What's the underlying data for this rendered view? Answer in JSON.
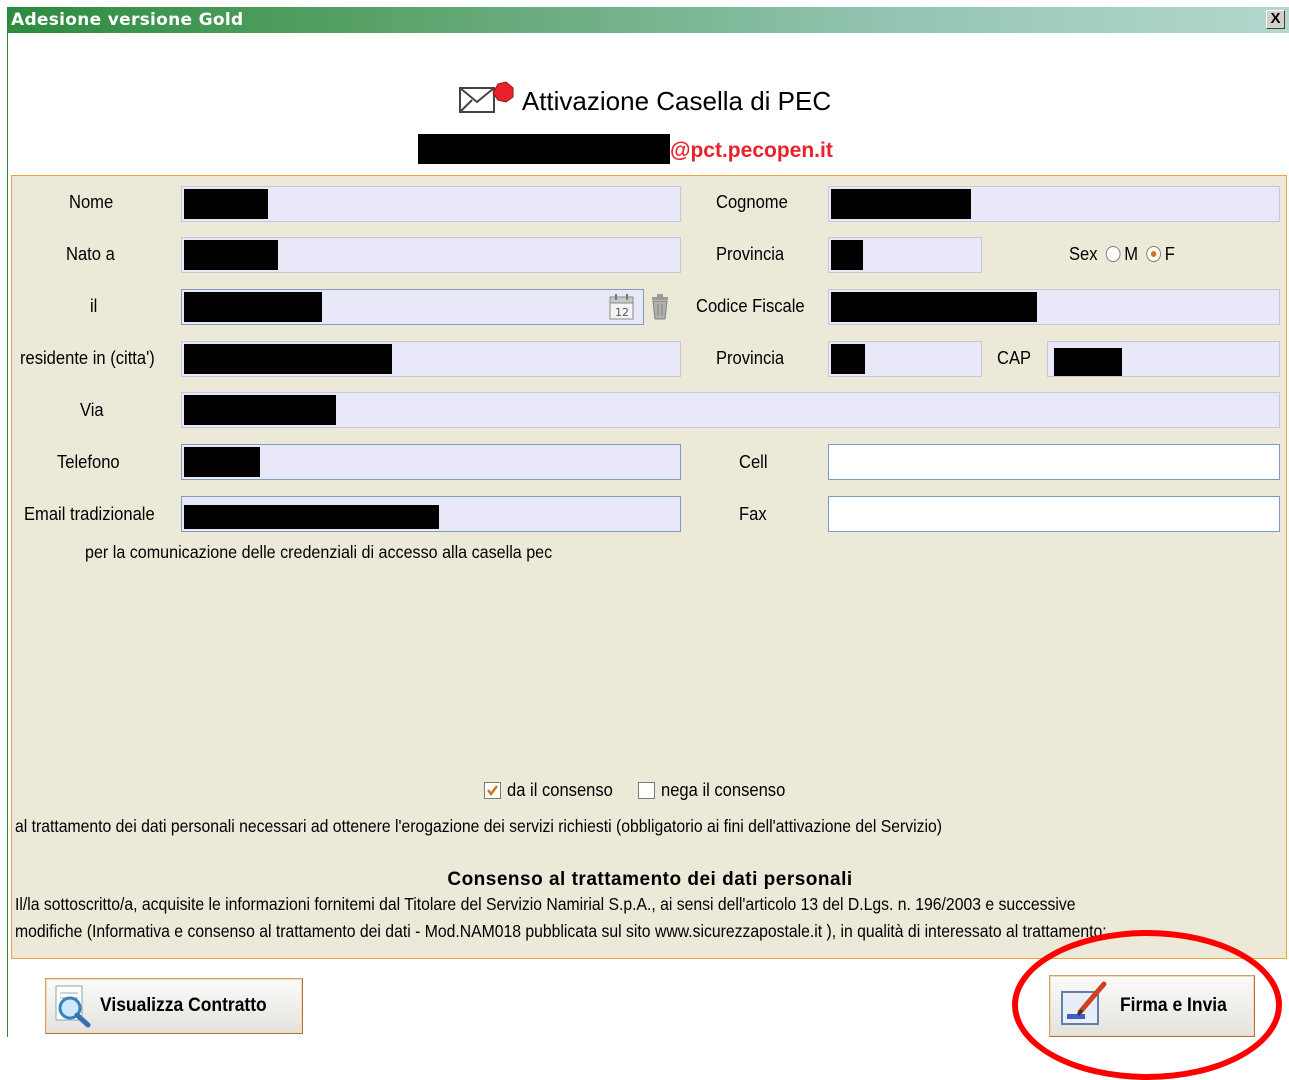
{
  "window": {
    "title": "Adesione versione Gold",
    "close_label": "X"
  },
  "heading": {
    "title": "Attivazione Casella di PEC",
    "email_domain": "@pct.pecopen.it"
  },
  "form": {
    "nome_label": "Nome",
    "cognome_label": "Cognome",
    "nato_label": "Nato a",
    "provincia_label": "Provincia",
    "sex_label": "Sex",
    "sex_m": "M",
    "sex_f": "F",
    "sex_selected": "F",
    "il_label": "il",
    "calendar_day": "12",
    "codice_fiscale_label": "Codice Fiscale",
    "residente_label": "residente in (citta')",
    "provincia2_label": "Provincia",
    "cap_label": "CAP",
    "via_label": "Via",
    "telefono_label": "Telefono",
    "cell_label": "Cell",
    "email_label": "Email tradizionale",
    "fax_label": "Fax",
    "email_note": "per la comunicazione delle credenziali di accesso alla casella pec"
  },
  "consent": {
    "title": "Consenso al trattamento dei dati personali",
    "line1": "Il/la sottoscritto/a, acquisite le informazioni fornitemi dal Titolare del Servizio Namirial S.p.A., ai sensi dell'articolo 13 del D.Lgs. n. 196/2003 e successive",
    "line2": "modifiche (Informativa e consenso al trattamento dei dati - Mod.NAM018 pubblicata sul sito www.sicurezzapostale.it ), in qualità di interessato al trattamento:",
    "give_label": "da il consenso",
    "deny_label": "nega il consenso",
    "give_checked": true,
    "deny_checked": false,
    "line3": "al trattamento dei dati personali necessari ad ottenere l'erogazione dei servizi richiesti (obbligatorio ai fini dell'attivazione del Servizio)"
  },
  "buttons": {
    "view_contract": "Visualizza Contratto",
    "sign_send": "Firma e Invia"
  },
  "colors": {
    "accent_red": "#e8222b",
    "panel_bg": "#ece9d8",
    "panel_border": "#f0a040",
    "field_bg": "#e8e8f8"
  }
}
